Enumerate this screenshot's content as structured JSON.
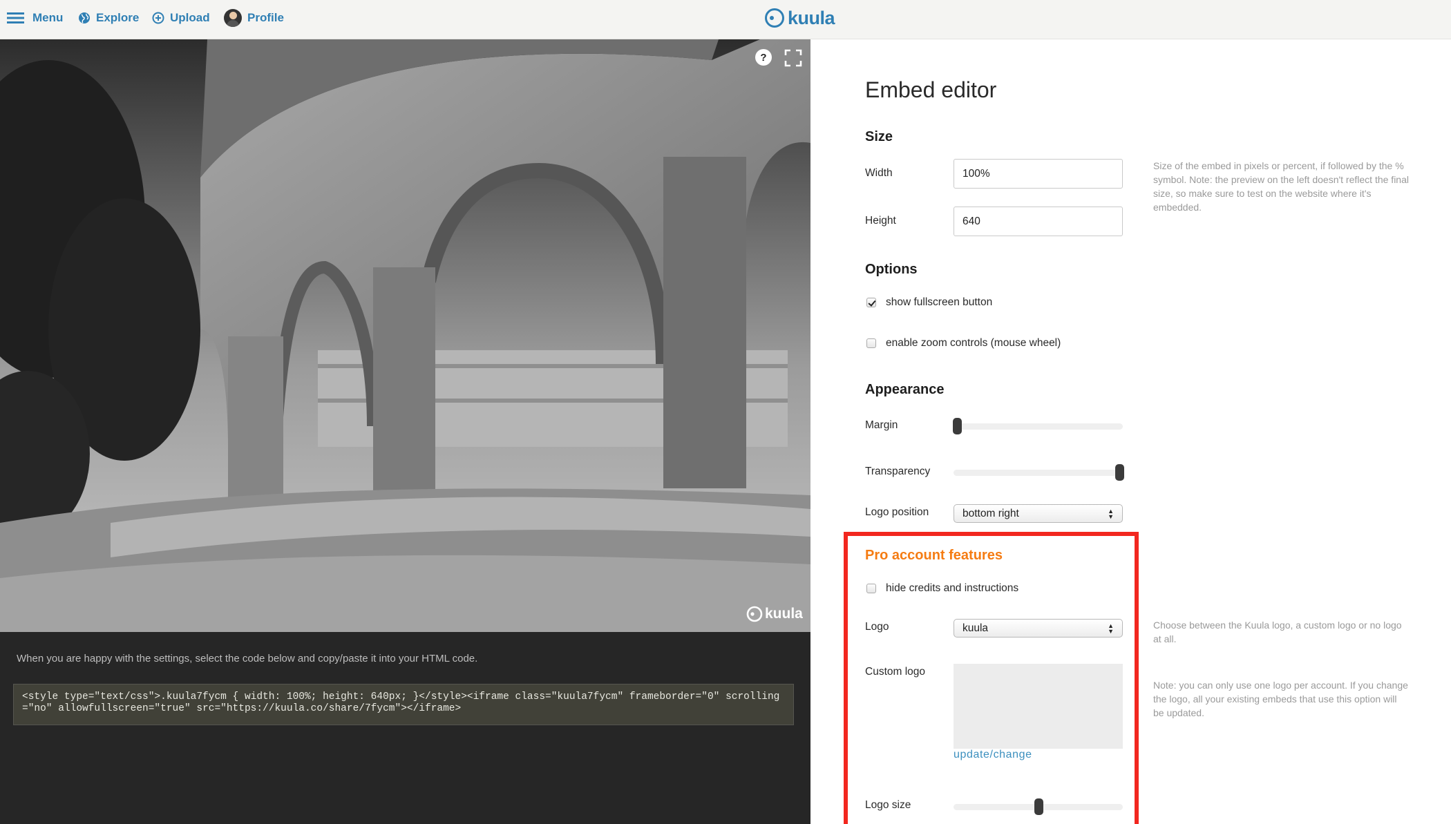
{
  "nav": {
    "menu": "Menu",
    "explore": "Explore",
    "upload": "Upload",
    "profile": "Profile",
    "brand": "kuula"
  },
  "preview": {
    "help_label": "?",
    "watermark": "kuula",
    "code_hint": "When you are happy with the settings, select the code below and copy/paste it into your HTML code.",
    "embed_code": "<style type=\"text/css\">.kuula7fycm { width: 100%; height: 640px; }</style><iframe class=\"kuula7fycm\" frameborder=\"0\" scrolling=\"no\" allowfullscreen=\"true\" src=\"https://kuula.co/share/7fycm\"></iframe>"
  },
  "editor": {
    "title": "Embed editor",
    "size": {
      "heading": "Size",
      "width_label": "Width",
      "width_value": "100%",
      "height_label": "Height",
      "height_value": "640",
      "help": "Size of the embed in pixels or percent, if followed by the % symbol. Note: the preview on the left doesn't reflect the final size, so make sure to test on the website where it's embedded."
    },
    "options": {
      "heading": "Options",
      "fullscreen_label": "show fullscreen button",
      "fullscreen_checked": true,
      "zoom_label": "enable zoom controls (mouse wheel)",
      "zoom_checked": false
    },
    "appearance": {
      "heading": "Appearance",
      "margin_label": "Margin",
      "margin_value": 0.02,
      "transparency_label": "Transparency",
      "transparency_value": 0.98,
      "logo_position_label": "Logo position",
      "logo_position_value": "bottom right"
    },
    "pro": {
      "heading": "Pro account features",
      "hide_credits_label": "hide credits and instructions",
      "hide_credits_checked": false,
      "logo_label": "Logo",
      "logo_value": "kuula",
      "logo_help": "Choose between the Kuula logo, a custom logo or no logo at all.",
      "custom_logo_label": "Custom logo",
      "custom_logo_help": "Note: you can only use one logo per account. If you change the logo, all your existing embeds that use this option will be updated.",
      "update_link": "update/change",
      "logo_size_label": "Logo size",
      "logo_size_value": 0.5
    }
  },
  "colors": {
    "link_blue": "#2f7fb4",
    "pro_orange": "#f57c13",
    "highlight_red": "#f2271f"
  }
}
